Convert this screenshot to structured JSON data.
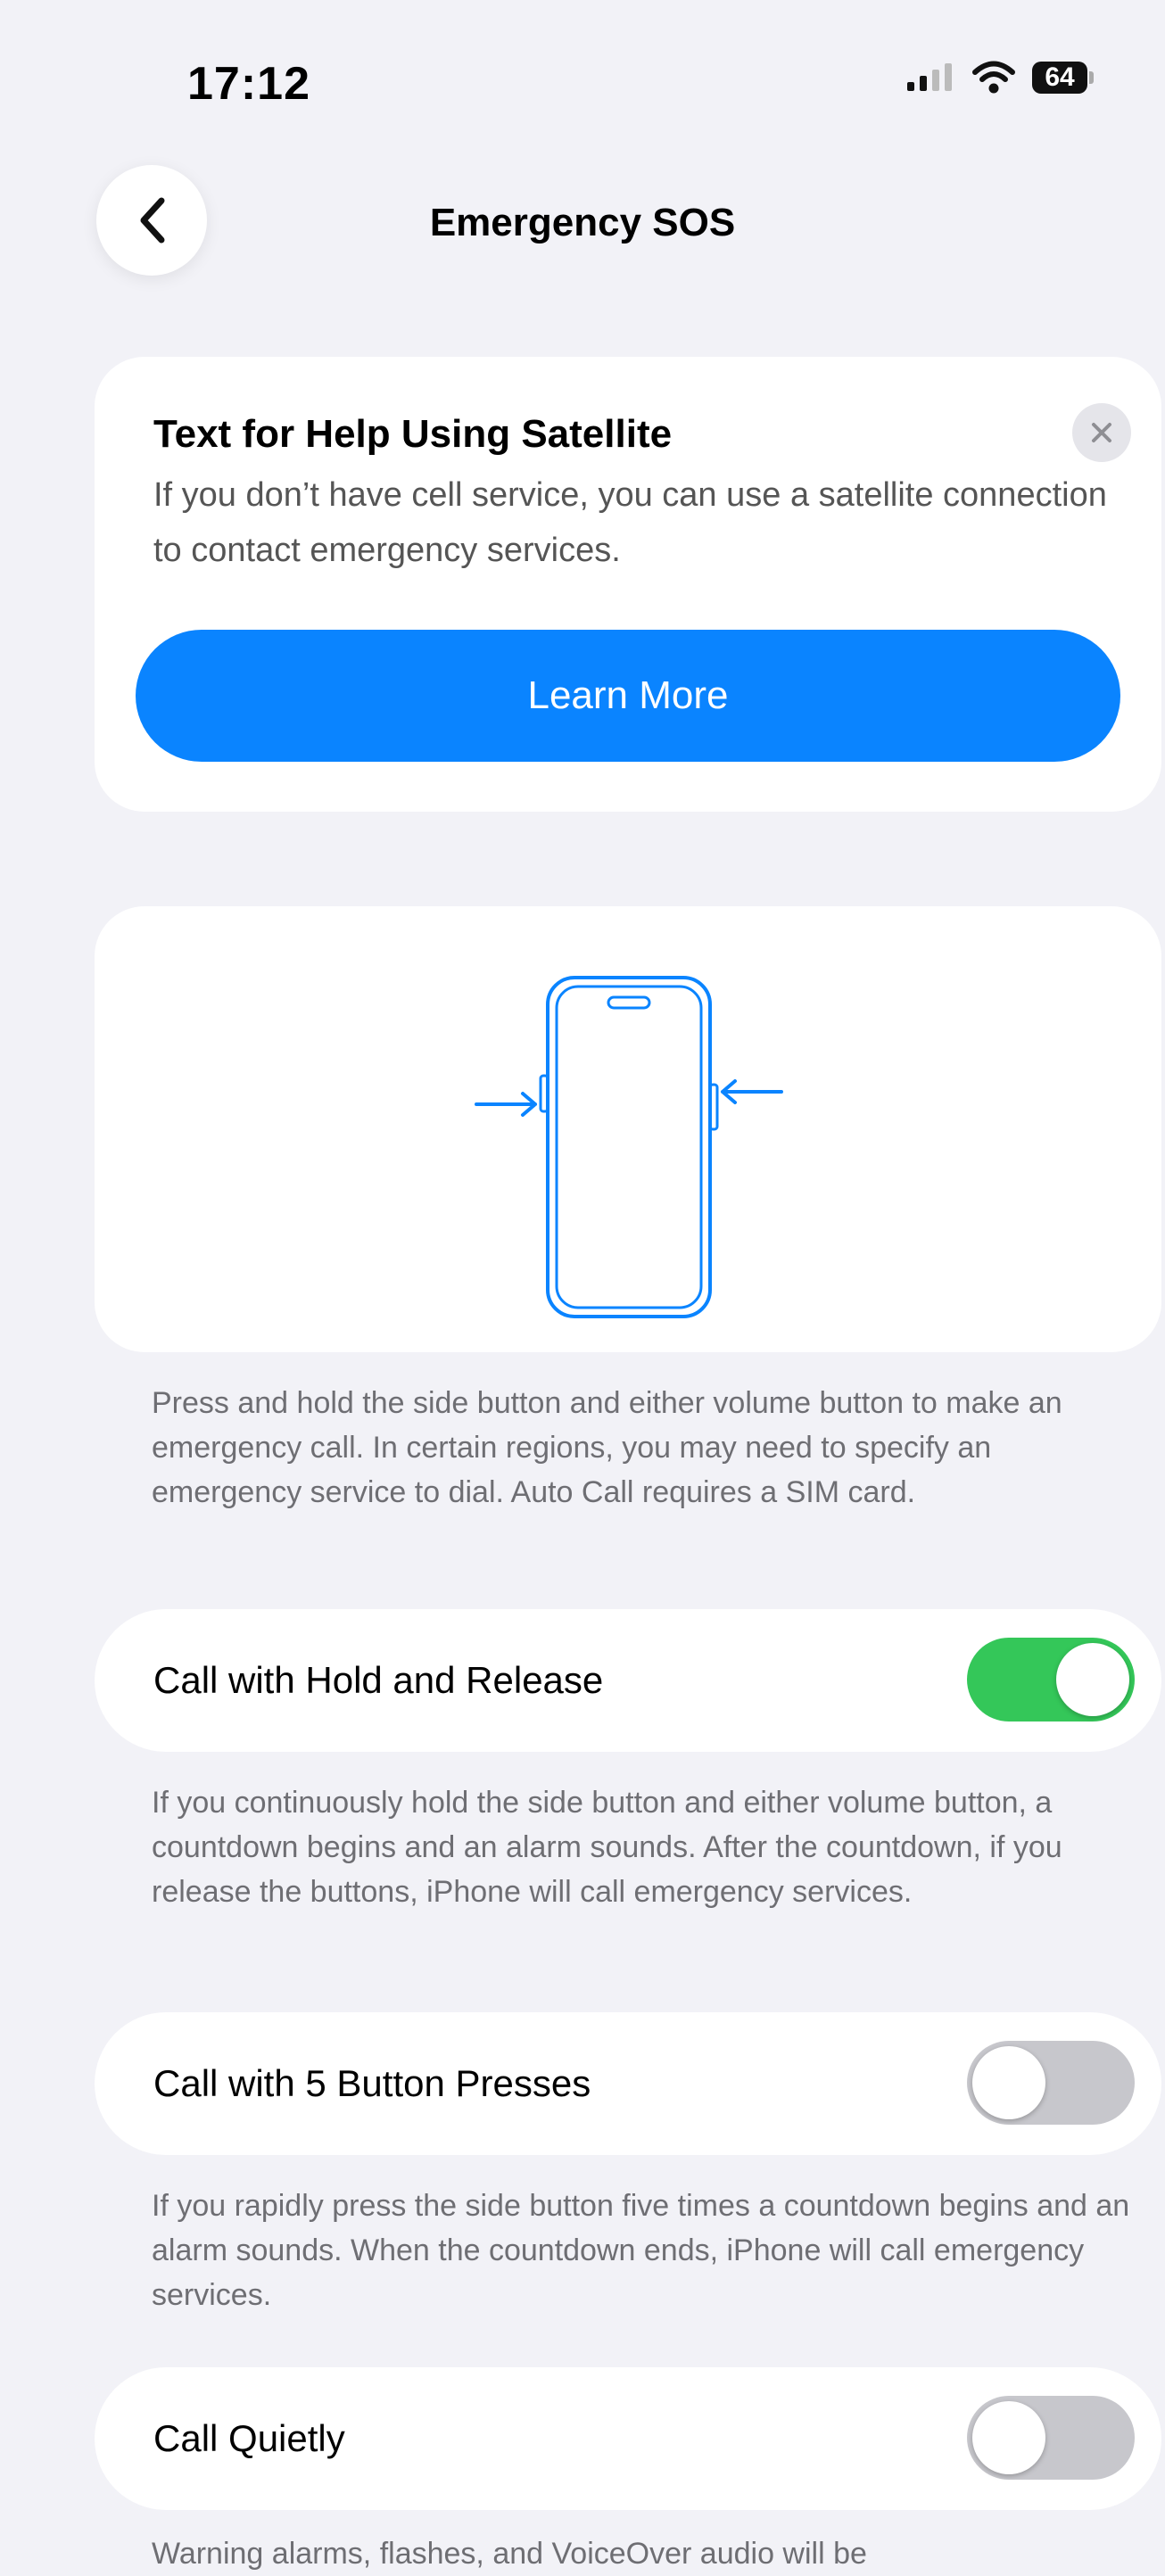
{
  "status_bar": {
    "time": "17:12",
    "battery": "64",
    "icons": [
      "signal-icon",
      "wifi-icon",
      "battery-icon"
    ]
  },
  "nav": {
    "title": "Emergency SOS",
    "back_icon": "chevron-left-icon"
  },
  "satellite_card": {
    "title": "Text for Help Using Satellite",
    "description": "If you don’t have cell service, you can use a satellite connection to contact emergency services.",
    "button_label": "Learn More",
    "close_icon": "close-icon"
  },
  "illustration": {
    "icon": "iphone-buttons-icon",
    "description": "Press and hold the side button and either volume button to make an emergency call. In certain regions, you may need to specify an emergency service to dial. Auto Call requires a SIM card."
  },
  "settings": [
    {
      "label": "Call with Hold and Release",
      "on": true,
      "description": "If you continuously hold the side button and either volume button, a countdown begins and an alarm sounds. After the countdown, if you release the buttons, iPhone will call emergency services."
    },
    {
      "label": "Call with 5 Button Presses",
      "on": false,
      "description": "If you rapidly press the side button five times a countdown begins and an alarm sounds. When the countdown ends, iPhone will call emergency services."
    },
    {
      "label": "Call Quietly",
      "on": false,
      "description": "Warning alarms, flashes, and VoiceOver audio will be"
    }
  ],
  "colors": {
    "accent": "#0a84ff",
    "toggle_on": "#34c759",
    "toggle_off": "#c7c7cc",
    "background": "#f2f2f7"
  }
}
